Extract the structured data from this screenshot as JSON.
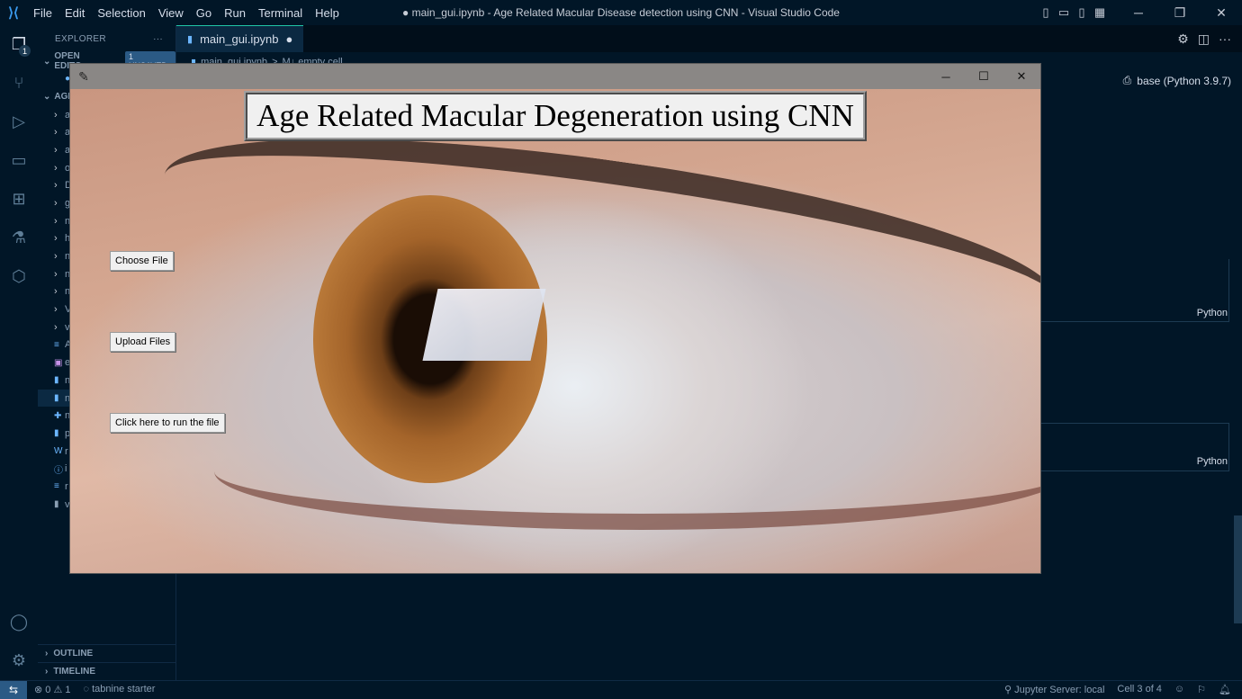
{
  "titlebar": {
    "menu": [
      "File",
      "Edit",
      "Selection",
      "View",
      "Go",
      "Run",
      "Terminal",
      "Help"
    ],
    "window_title": "● main_gui.ipynb - Age Related Macular Disease detection using CNN - Visual Studio Code"
  },
  "activity": {
    "explorer_badge": "1"
  },
  "sidebar": {
    "header": "EXPLORER",
    "more": "···",
    "open_editors": "OPEN EDITO",
    "unsaved": "1 UNSAVED",
    "folder": "AGI",
    "items": [
      "a",
      "a",
      "a",
      "o",
      "D",
      "g",
      "n",
      "h",
      "n",
      "n",
      "n",
      "V",
      "v",
      "A",
      "e",
      "n",
      "n",
      "n",
      "p",
      "r",
      "i",
      "r",
      "v"
    ],
    "outline": "OUTLINE",
    "timeline": "TIMELINE"
  },
  "editor": {
    "tab_label": "main_gui.ipynb",
    "breadcrumb_file": "main_gui.ipynb",
    "breadcrumb_sep": ">",
    "breadcrumb_cell": "M↓ empty cell",
    "kernel": "base (Python 3.9.7)",
    "cell_lang_1": "Python",
    "cell_lang_2": "Python"
  },
  "tk_app": {
    "heading": "Age Related Macular Degeneration using CNN",
    "buttons": {
      "choose": "Choose File",
      "upload": "Upload Files",
      "run": "Click here to run the file"
    }
  },
  "statusbar": {
    "errors": "⊗ 0",
    "warnings": "⚠ 1",
    "tabnine": "tabnine starter",
    "jupyter": "Jupyter Server: local",
    "cell": "Cell 3 of 4"
  }
}
